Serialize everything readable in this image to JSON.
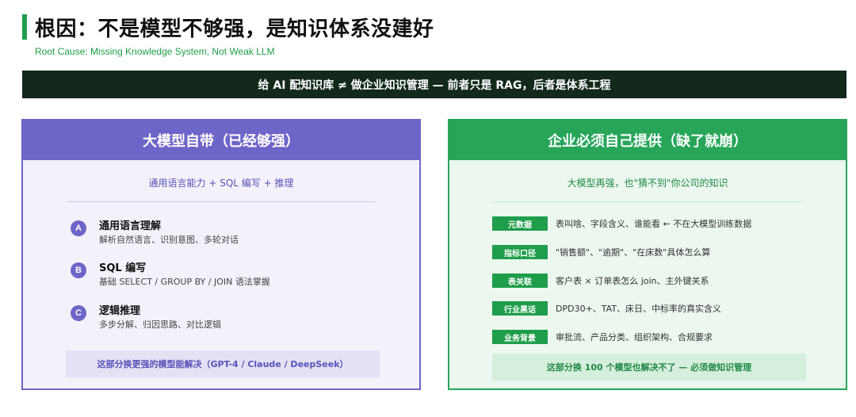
{
  "title": "根因：不是模型不够强，是知识体系没建好",
  "subtitle": "Root Cause: Missing Knowledge System, Not Weak LLM",
  "banner": "给 AI 配知识库 ≠ 做企业知识管理 — 前者只是 RAG，后者是体系工程",
  "left_panel": {
    "header": "大模型自带（已经够强）",
    "sub": "通用语言能力 + SQL 编写 + 推理",
    "items": [
      {
        "badge": "A",
        "title": "通用语言理解",
        "desc": "解析自然语言、识别意图、多轮对话"
      },
      {
        "badge": "B",
        "title": "SQL 编写",
        "desc": "基础 SELECT / GROUP BY / JOIN 语法掌握"
      },
      {
        "badge": "C",
        "title": "逻辑推理",
        "desc": "多步分解、归因思路、对比逻辑"
      }
    ],
    "footer": "这部分换更强的模型能解决（GPT-4 / Claude / DeepSeek）"
  },
  "right_panel": {
    "header": "企业必须自己提供（缺了就崩）",
    "sub": "大模型再强，也\"猜不到\"你公司的知识",
    "rows": [
      {
        "tag": "元数据",
        "text": "表叫啥、字段含义、谁能看 ← 不在大模型训练数据"
      },
      {
        "tag": "指标口径",
        "text": "\"销售额\"、\"逾期\"、\"在床数\"具体怎么算"
      },
      {
        "tag": "表关联",
        "text": "客户表 × 订单表怎么 join、主外键关系"
      },
      {
        "tag": "行业黑话",
        "text": "DPD30+、TAT、床日、中标率的真实含义"
      },
      {
        "tag": "业务背景",
        "text": "审批流、产品分类、组织架构、合规要求"
      }
    ],
    "footer": "这部分换 100 个模型也解决不了 — 必须做知识管理"
  }
}
